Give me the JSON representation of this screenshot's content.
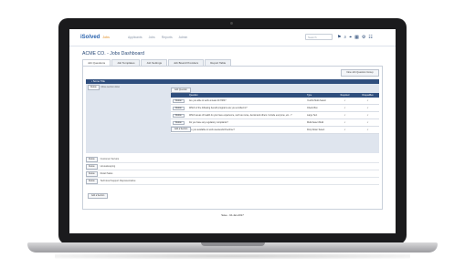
{
  "app": {
    "logo": "iSolved",
    "logo_sub": "Jobs",
    "nav": [
      "Applicants",
      "Jobs",
      "Reports",
      "Admin"
    ],
    "search_placeholder": "Search",
    "icons": [
      "flag-icon",
      "search-icon",
      "pin-icon",
      "calendar-icon",
      "gear-icon",
      "users-icon"
    ]
  },
  "page": {
    "title": "ACME CO. - Jobs Dashboard",
    "tabs": [
      "Job Questions",
      "Job Templates",
      "Job Settings",
      "Job Board Providers",
      "Report Table"
    ],
    "new_button": "New Job Question Group",
    "section_header": "• Some Title",
    "section_buttons": [
      "Delete",
      "Move section down"
    ],
    "add_question": "Add Question",
    "add_section": "Add a Section",
    "columns": {
      "question": "Question",
      "type": "Type",
      "required": "Required",
      "disqualifies": "Disqualifies"
    },
    "questions": [
      {
        "btn": "Delete",
        "text": "Are you able to work at least 40 HRS?",
        "type": "Yes/No Multi-Select",
        "req": "✓",
        "dq": "✓"
      },
      {
        "btn": "Delete",
        "text": "Which of the following benefit programs are you enrolled in?",
        "type": "Check Box",
        "req": "✓",
        "dq": "✓"
      },
      {
        "btn": "Delete",
        "text": "Which areas of health do you have experience, such as nurse, dental and others. Include everyone, etc...?",
        "type": "Large Text",
        "req": "✓",
        "dq": "✓"
      },
      {
        "btn": "Delete",
        "text": "Do you have any regulatory complaints?",
        "type": "Multi-Select Multi",
        "req": "✓",
        "dq": "✓"
      },
      {
        "btn": "Delete",
        "text": "Are you available to work weekends/Overtime?",
        "type": "Drop Down Select",
        "req": "✓",
        "dq": "✓"
      }
    ],
    "sections": [
      {
        "btn": "Delete",
        "label": "Customer Service"
      },
      {
        "btn": "Delete",
        "label": "Housekeeping"
      },
      {
        "btn": "Delete",
        "label": "Retail Sales"
      },
      {
        "btn": "Delete",
        "label": "Technical Support Representative"
      }
    ],
    "add_main_section": "Add a Section",
    "saved": "Save - 10-Jan-2017"
  }
}
